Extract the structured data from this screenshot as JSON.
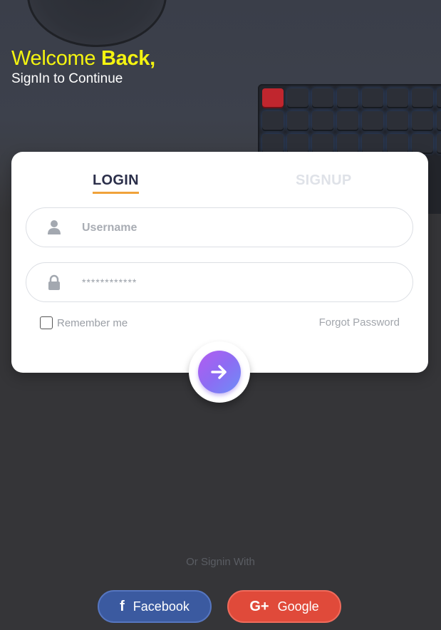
{
  "header": {
    "welcome_prefix": "Welcome",
    "welcome_strong": "Back,",
    "subtitle": "SignIn to Continue"
  },
  "tabs": {
    "login": "LOGIN",
    "signup": "SIGNUP",
    "active": "LOGIN"
  },
  "form": {
    "username_placeholder": "Username",
    "password_placeholder": "************",
    "remember_label": "Remember me",
    "forgot_label": "Forgot Password",
    "submit_icon": "arrow-right-icon"
  },
  "social": {
    "divider_text": "Or Signin With",
    "facebook_label": "Facebook",
    "facebook_icon_glyph": "f",
    "google_label": "Google",
    "google_icon_glyph": "G+"
  },
  "colors": {
    "welcome_yellow": "#f4f410",
    "tab_underline": "#f0a23a",
    "facebook": "#3b5aa0",
    "google": "#e04a3a",
    "submit_gradient_start": "#b35cf0",
    "submit_gradient_end": "#6d8ef7",
    "background": "#353538"
  }
}
